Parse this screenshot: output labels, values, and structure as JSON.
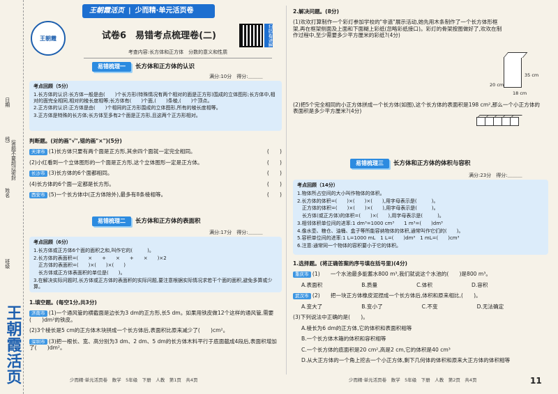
{
  "banner": {
    "brand": "王朝霞活页",
    "series": "少而精·单元活页卷"
  },
  "logo_badge": "王朝霞",
  "qr_label": "扫码看讲解",
  "title": "试卷6　易错考点梳理卷(二)",
  "subtitle": "考查内容:长方体和正方体　分数的意义和性质",
  "strip": {
    "labels": [
      "日期",
      "（答题不要超过密封线）",
      "姓名",
      "班级"
    ]
  },
  "brand_vertical": "王朝霞活页",
  "sec1": {
    "tag": "易错梳理一",
    "title": "长方体和正方体的认识",
    "score": "满分:10分　得分:＿＿＿",
    "review_title": "考点回顾（5分）",
    "review_lines": [
      "1.长方体的认识:长方体一般是由(　　)个长方形(特殊情况有两个相对的面是正方形)围成的立体图形;长方体中,相对的面完全相同,相对的棱长度相等;长方体有(　　)个面,(　　)条棱,(　　)个顶点。",
      "2.正方体的认识:正方体是由(　　)个相同的正方形围成的立体图形,所有的棱长度相等。",
      "3.正方体是特殊的长方体;长方体至多有2个面是正方形,且这两个正方形相对。"
    ],
    "judge_title": "判断题。(对的画\"√\",错的画\"×\")(5分)",
    "judge": [
      {
        "city": "天津市",
        "text": "(1)长方体只要有两个面是正方形,其余四个面就一定完全相同。"
      },
      {
        "city": "",
        "text": "(2)小红看到一个立体图形的一个面是正方形,这个立体图形一定是正方体。"
      },
      {
        "city": "长沙市",
        "text": "(3)长方体的6个面都相同。"
      },
      {
        "city": "",
        "text": "(4)长方体的6个面一定都是长方形。"
      },
      {
        "city": "西安市",
        "text": "(5)一个长方体中(正方体除外),最多有8条棱相等。"
      }
    ]
  },
  "sec2": {
    "tag": "易错梳理二",
    "title": "长方体和正方体的表面积",
    "score": "满分:17分　得分:＿＿＿",
    "review_title": "考点回顾（6分）",
    "review_lines": [
      "1.长方体或正方体6个面的面积之和,叫作它的(　　　)。",
      "2.长方体的表面积=(　　×　　+　　×　　+　　×　　)×2",
      "　正方体的表面积=(　　)×(　　)×(　　)",
      "　长方体或正方体表面积的单位是(　　)。",
      "3.在解决实际问题时,长方体或正方体的表面积的实际问题,要注意根据实际情况求若干个面的面积,避免多算或少算。"
    ],
    "fill_title": "1.填空题。(每空1分,共3分)",
    "fill": [
      {
        "city": "济南市",
        "text": "(1)一个通风管的横截面是边长为3 dm的正方形,长5 dm。如果用铁皮做12个这样的通风管,需要(　　)dm²的铁皮。"
      },
      {
        "city": "",
        "text": "(2)3个棱长是5 cm的正方体木块拼成一个长方体后,表面积比原来减少了(　　)cm²。"
      },
      {
        "city": "深圳市",
        "text": "(3)把一根长、宽、高分别为3 dm、2 dm、5 dm的长方体木料平行于底面截成4段后,表面积增加了(　　)dm²。"
      }
    ]
  },
  "right": {
    "solve_title": "2.解决问题。(8分)",
    "solve": [
      "(1)欢欢打算制作一个彩灯参加学校的\"非遗\"展示活动,她先用木条制作了一个长方体形框架,再在框架侧面及上面和下面糊上彩纸(忽略彩纸接口)。彩灯的骨架按图做好了,欢欢在制作过程中,至少需要多少平方厘米的彩纸?(4分)",
      "(2)把5个完全相同的小正方体拼成一个长方体(如图),这个长方体的表面积是198 cm²,那么一个小正方体的表面积是多少平方厘米?(4分)"
    ],
    "dims": {
      "h": "35 cm",
      "l": "20 cm",
      "w": "18 cm"
    }
  },
  "sec3": {
    "tag": "易错梳理三",
    "title": "长方体和正方体的体积与容积",
    "score": "满分:23分　得分:＿＿＿",
    "review_title": "考点回顾（14分）",
    "review_lines": [
      "1.物体所占空间的大小叫作物体的体积。",
      "2.长方体的体积=(　　)×(　　)×(　　),用字母表示是(　　　)。",
      "　正方体的体积=(　　)×(　　)×(　　),用字母表示是(　　　)。",
      "　长方体(或正方体)的体积=(　　)×(　　),用字母表示是(　　　)。",
      "3.相邻体积单位间的进率:1 dm³=1000 cm³　　1 m³=(　　)dm³",
      "4.像水壶、粮仓、油桶、盒子等所能容纳物体的体积,通常叫作它们的(　　)。",
      "5.容积单位间的进率:1 L=1000 mL　1 L=(　　)dm³　1 mL=(　　)cm³",
      "6.注意:通常同一个物体的容积要小于它的体积。"
    ],
    "choice_title": "1.选择题。(将正确答案的序号填在括号里)(4分)",
    "choices": [
      {
        "city": "重庆市",
        "stem": "(1)　　一个水池最多能蓄水800 m³,我们就说这个水池的(　　)是800 m³。",
        "opts": [
          "A.表面积",
          "B.质量",
          "C.体积",
          "D.容积"
        ]
      },
      {
        "city": "武汉市",
        "stem": "(2)　　把一块正方体橡皮泥捏成一个长方体后,体积和原来相比,(　　)。",
        "opts": [
          "A.变大了",
          "B.变小了",
          "C.不变",
          "D.无法确定"
        ]
      },
      {
        "city": "",
        "stem": "(3)下列说法中正确的是(　　)。",
        "opts": [
          "A.棱长为6 dm的正方体,它的体积和表面积相等",
          "B.一个长方体木箱的体积和容积相等",
          "C.一个长方体的底面积是20 cm²,高是2 cm,它的体积是40 cm³",
          "D.从大正方体的一个角上挖去一个小正方体,剩下几何体的体积和原来大正方体的体积相等"
        ]
      }
    ]
  },
  "footer_left": "少而精·单元活页卷　数学　5年级　下册　人教　第1页　共4页",
  "footer_right": "少而精·单元活页卷　数学　5年级　下册　人教　第2页　共4页",
  "page_number": "11"
}
